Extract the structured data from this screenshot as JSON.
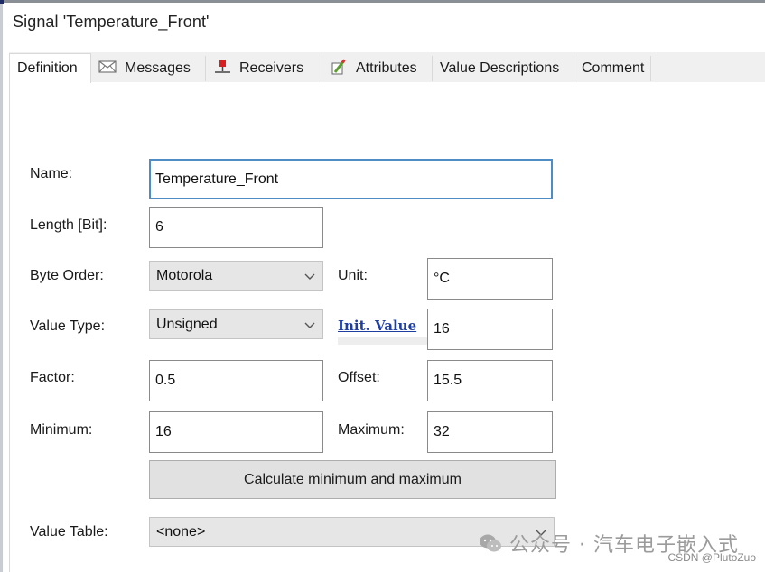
{
  "window": {
    "title": "Signal 'Temperature_Front'"
  },
  "tabs": [
    {
      "label": "Definition",
      "icon": "none",
      "active": true
    },
    {
      "label": "Messages",
      "icon": "envelope-icon",
      "active": false
    },
    {
      "label": "Receivers",
      "icon": "network-node-icon",
      "active": false
    },
    {
      "label": "Attributes",
      "icon": "edit-pencil-icon",
      "active": false
    },
    {
      "label": "Value Descriptions",
      "icon": "none",
      "active": false
    },
    {
      "label": "Comment",
      "icon": "none",
      "active": false
    }
  ],
  "form": {
    "name": {
      "label": "Name:",
      "value": "Temperature_Front"
    },
    "length": {
      "label": "Length [Bit]:",
      "value": "6"
    },
    "byte_order": {
      "label": "Byte Order:",
      "value": "Motorola"
    },
    "unit": {
      "label": "Unit:",
      "value": "°C"
    },
    "value_type": {
      "label": "Value Type:",
      "value": "Unsigned"
    },
    "init_value": {
      "label": "Init. Value",
      "value": "16"
    },
    "factor": {
      "label": "Factor:",
      "value": "0.5"
    },
    "offset": {
      "label": "Offset:",
      "value": "15.5"
    },
    "minimum": {
      "label": "Minimum:",
      "value": "16"
    },
    "maximum": {
      "label": "Maximum:",
      "value": "32"
    },
    "calculate_button": "Calculate minimum and maximum",
    "value_table": {
      "label": "Value Table:",
      "value": "<none>"
    }
  },
  "watermark": {
    "text": "公众号 · 汽车电子嵌入式",
    "credit": "CSDN @PlutoZuo"
  },
  "colors": {
    "focus_border": "#4d8cc4",
    "link": "#1f3fa0",
    "combo_bg": "#e6e6e6",
    "button_bg": "#e1e1e1"
  }
}
